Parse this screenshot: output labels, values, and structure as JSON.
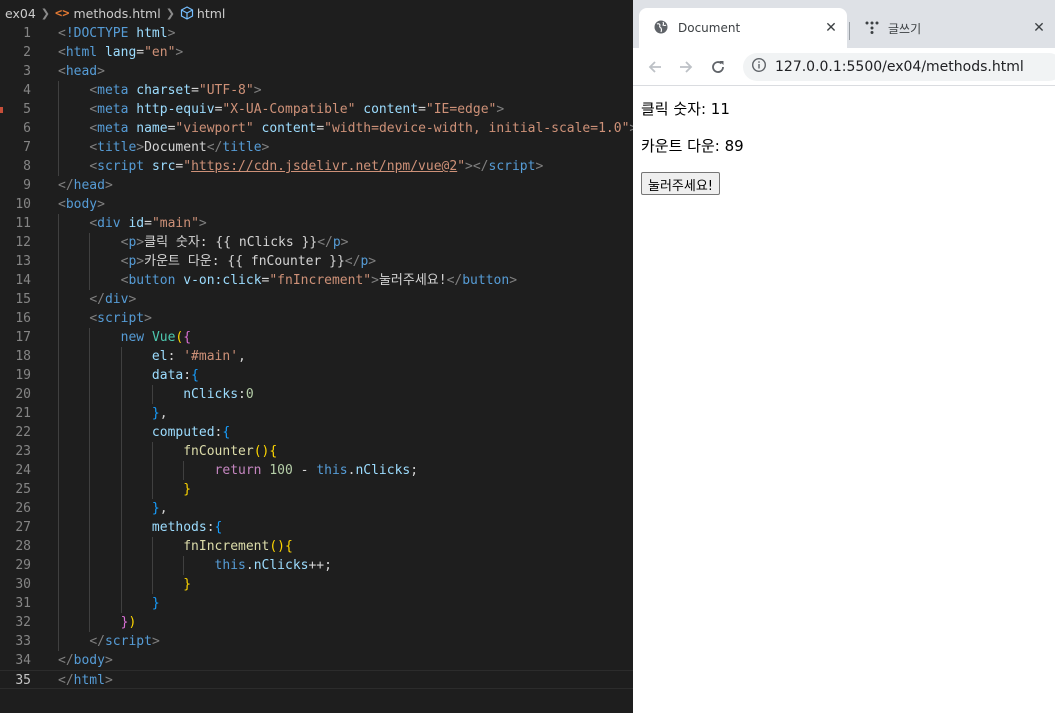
{
  "editor": {
    "breadcrumb": {
      "folder": "ex04",
      "file": "methods.html",
      "symbol": "html"
    },
    "lines": [
      {
        "n": "1",
        "code": [
          [
            "p",
            "<"
          ],
          [
            "t",
            "!DOCTYPE"
          ],
          [
            "w",
            " "
          ],
          [
            "a",
            "html"
          ],
          [
            "p",
            ">"
          ]
        ]
      },
      {
        "n": "2",
        "code": [
          [
            "p",
            "<"
          ],
          [
            "t",
            "html"
          ],
          [
            "w",
            " "
          ],
          [
            "a",
            "lang"
          ],
          [
            "w",
            "="
          ],
          [
            "s",
            "\"en\""
          ],
          [
            "p",
            ">"
          ]
        ]
      },
      {
        "n": "3",
        "code": [
          [
            "p",
            "<"
          ],
          [
            "t",
            "head"
          ],
          [
            "p",
            ">"
          ]
        ]
      },
      {
        "n": "4",
        "code": [
          [
            "w",
            "    "
          ],
          [
            "p",
            "<"
          ],
          [
            "t",
            "meta"
          ],
          [
            "w",
            " "
          ],
          [
            "a",
            "charset"
          ],
          [
            "w",
            "="
          ],
          [
            "s",
            "\"UTF-8\""
          ],
          [
            "p",
            ">"
          ]
        ]
      },
      {
        "n": "5",
        "code": [
          [
            "w",
            "    "
          ],
          [
            "p",
            "<"
          ],
          [
            "t",
            "meta"
          ],
          [
            "w",
            " "
          ],
          [
            "a",
            "http-equiv"
          ],
          [
            "w",
            "="
          ],
          [
            "s",
            "\"X-UA-Compatible\""
          ],
          [
            "w",
            " "
          ],
          [
            "a",
            "content"
          ],
          [
            "w",
            "="
          ],
          [
            "s",
            "\"IE=edge\""
          ],
          [
            "p",
            ">"
          ]
        ]
      },
      {
        "n": "6",
        "code": [
          [
            "w",
            "    "
          ],
          [
            "p",
            "<"
          ],
          [
            "t",
            "meta"
          ],
          [
            "w",
            " "
          ],
          [
            "a",
            "name"
          ],
          [
            "w",
            "="
          ],
          [
            "s",
            "\"viewport\""
          ],
          [
            "w",
            " "
          ],
          [
            "a",
            "content"
          ],
          [
            "w",
            "="
          ],
          [
            "s",
            "\"width=device-width, initial-scale=1.0\""
          ],
          [
            "p",
            ">"
          ]
        ]
      },
      {
        "n": "7",
        "code": [
          [
            "w",
            "    "
          ],
          [
            "p",
            "<"
          ],
          [
            "t",
            "title"
          ],
          [
            "p",
            ">"
          ],
          [
            "w",
            "Document"
          ],
          [
            "p",
            "</"
          ],
          [
            "t",
            "title"
          ],
          [
            "p",
            ">"
          ]
        ]
      },
      {
        "n": "8",
        "code": [
          [
            "w",
            "    "
          ],
          [
            "p",
            "<"
          ],
          [
            "t",
            "script"
          ],
          [
            "w",
            " "
          ],
          [
            "a",
            "src"
          ],
          [
            "w",
            "="
          ],
          [
            "s",
            "\""
          ],
          [
            "u",
            "https://cdn.jsdelivr.net/npm/vue@2"
          ],
          [
            "s",
            "\""
          ],
          [
            "p",
            "></"
          ],
          [
            "t",
            "script"
          ],
          [
            "p",
            ">"
          ]
        ]
      },
      {
        "n": "9",
        "code": [
          [
            "p",
            "</"
          ],
          [
            "t",
            "head"
          ],
          [
            "p",
            ">"
          ]
        ]
      },
      {
        "n": "10",
        "code": [
          [
            "p",
            "<"
          ],
          [
            "t",
            "body"
          ],
          [
            "p",
            ">"
          ]
        ]
      },
      {
        "n": "11",
        "code": [
          [
            "w",
            "    "
          ],
          [
            "p",
            "<"
          ],
          [
            "t",
            "div"
          ],
          [
            "w",
            " "
          ],
          [
            "a",
            "id"
          ],
          [
            "w",
            "="
          ],
          [
            "s",
            "\"main\""
          ],
          [
            "p",
            ">"
          ]
        ]
      },
      {
        "n": "12",
        "code": [
          [
            "w",
            "        "
          ],
          [
            "p",
            "<"
          ],
          [
            "t",
            "p"
          ],
          [
            "p",
            ">"
          ],
          [
            "w",
            "클릭 숫자: {{ nClicks }}"
          ],
          [
            "p",
            "</"
          ],
          [
            "t",
            "p"
          ],
          [
            "p",
            ">"
          ]
        ]
      },
      {
        "n": "13",
        "code": [
          [
            "w",
            "        "
          ],
          [
            "p",
            "<"
          ],
          [
            "t",
            "p"
          ],
          [
            "p",
            ">"
          ],
          [
            "w",
            "카운트 다운: {{ fnCounter }}"
          ],
          [
            "p",
            "</"
          ],
          [
            "t",
            "p"
          ],
          [
            "p",
            ">"
          ]
        ]
      },
      {
        "n": "14",
        "code": [
          [
            "w",
            "        "
          ],
          [
            "p",
            "<"
          ],
          [
            "t",
            "button"
          ],
          [
            "w",
            " "
          ],
          [
            "a",
            "v-on:click"
          ],
          [
            "w",
            "="
          ],
          [
            "s",
            "\"fnIncrement\""
          ],
          [
            "p",
            ">"
          ],
          [
            "w",
            "눌러주세요!"
          ],
          [
            "p",
            "</"
          ],
          [
            "t",
            "button"
          ],
          [
            "p",
            ">"
          ]
        ]
      },
      {
        "n": "15",
        "code": [
          [
            "w",
            "    "
          ],
          [
            "p",
            "</"
          ],
          [
            "t",
            "div"
          ],
          [
            "p",
            ">"
          ]
        ]
      },
      {
        "n": "16",
        "code": [
          [
            "w",
            "    "
          ],
          [
            "p",
            "<"
          ],
          [
            "t",
            "script"
          ],
          [
            "p",
            ">"
          ]
        ]
      },
      {
        "n": "17",
        "code": [
          [
            "w",
            "        "
          ],
          [
            "k",
            "new"
          ],
          [
            "w",
            " "
          ],
          [
            "cl",
            "Vue"
          ],
          [
            "y",
            "("
          ],
          [
            "m",
            "{"
          ]
        ]
      },
      {
        "n": "18",
        "code": [
          [
            "w",
            "            "
          ],
          [
            "a",
            "el"
          ],
          [
            "w",
            ": "
          ],
          [
            "s",
            "'#main'"
          ],
          [
            "w",
            ","
          ]
        ]
      },
      {
        "n": "19",
        "code": [
          [
            "w",
            "            "
          ],
          [
            "a",
            "data"
          ],
          [
            "w",
            ":"
          ],
          [
            "b",
            "{"
          ]
        ]
      },
      {
        "n": "20",
        "code": [
          [
            "w",
            "                "
          ],
          [
            "a",
            "nClicks"
          ],
          [
            "w",
            ":"
          ],
          [
            "n",
            "0"
          ]
        ]
      },
      {
        "n": "21",
        "code": [
          [
            "w",
            "            "
          ],
          [
            "b",
            "}"
          ],
          [
            "w",
            ","
          ]
        ]
      },
      {
        "n": "22",
        "code": [
          [
            "w",
            "            "
          ],
          [
            "a",
            "computed"
          ],
          [
            "w",
            ":"
          ],
          [
            "b",
            "{"
          ]
        ]
      },
      {
        "n": "23",
        "code": [
          [
            "w",
            "                "
          ],
          [
            "f",
            "fnCounter"
          ],
          [
            "y",
            "(){"
          ]
        ]
      },
      {
        "n": "24",
        "code": [
          [
            "w",
            "                    "
          ],
          [
            "c",
            "return"
          ],
          [
            "w",
            " "
          ],
          [
            "n",
            "100"
          ],
          [
            "w",
            " - "
          ],
          [
            "k",
            "this"
          ],
          [
            "w",
            "."
          ],
          [
            "a",
            "nClicks"
          ],
          [
            "w",
            ";"
          ]
        ]
      },
      {
        "n": "25",
        "code": [
          [
            "w",
            "                "
          ],
          [
            "y",
            "}"
          ]
        ]
      },
      {
        "n": "26",
        "code": [
          [
            "w",
            "            "
          ],
          [
            "b",
            "}"
          ],
          [
            "w",
            ","
          ]
        ]
      },
      {
        "n": "27",
        "code": [
          [
            "w",
            "            "
          ],
          [
            "a",
            "methods"
          ],
          [
            "w",
            ":"
          ],
          [
            "b",
            "{"
          ]
        ]
      },
      {
        "n": "28",
        "code": [
          [
            "w",
            "                "
          ],
          [
            "f",
            "fnIncrement"
          ],
          [
            "y",
            "(){"
          ]
        ]
      },
      {
        "n": "29",
        "code": [
          [
            "w",
            "                    "
          ],
          [
            "k",
            "this"
          ],
          [
            "w",
            "."
          ],
          [
            "a",
            "nClicks"
          ],
          [
            "w",
            "++;"
          ]
        ]
      },
      {
        "n": "30",
        "code": [
          [
            "w",
            "                "
          ],
          [
            "y",
            "}"
          ]
        ]
      },
      {
        "n": "31",
        "code": [
          [
            "w",
            "            "
          ],
          [
            "b",
            "}"
          ]
        ]
      },
      {
        "n": "32",
        "code": [
          [
            "w",
            "        "
          ],
          [
            "m",
            "}"
          ],
          [
            "y",
            ")"
          ]
        ]
      },
      {
        "n": "33",
        "code": [
          [
            "w",
            "    "
          ],
          [
            "p",
            "</"
          ],
          [
            "t",
            "script"
          ],
          [
            "p",
            ">"
          ]
        ]
      },
      {
        "n": "34",
        "code": [
          [
            "p",
            "</"
          ],
          [
            "t",
            "body"
          ],
          [
            "p",
            ">"
          ]
        ]
      },
      {
        "n": "35",
        "code": [
          [
            "p",
            "</"
          ],
          [
            "t",
            "html"
          ],
          [
            "p",
            ">"
          ]
        ]
      }
    ],
    "current_line": "35",
    "modified_line": "5"
  },
  "browser": {
    "tabs": [
      {
        "title": "Document",
        "active": true,
        "icon": "globe-icon"
      },
      {
        "title": "글쓰기",
        "active": false,
        "icon": "dots-logo-icon"
      }
    ],
    "close_glyph": "✕",
    "url": "127.0.0.1:5500/ex04/methods.html",
    "page": {
      "clicks_text": "클릭 숫자: 11",
      "counter_text": "카운트 다운: 89",
      "button_label": "눌러주세요!"
    }
  },
  "colors": {
    "editor_bg": "#1e1e1e",
    "tab_bar_bg": "#dee1e6",
    "accent_tag": "#569cd6",
    "accent_string": "#ce9178"
  }
}
